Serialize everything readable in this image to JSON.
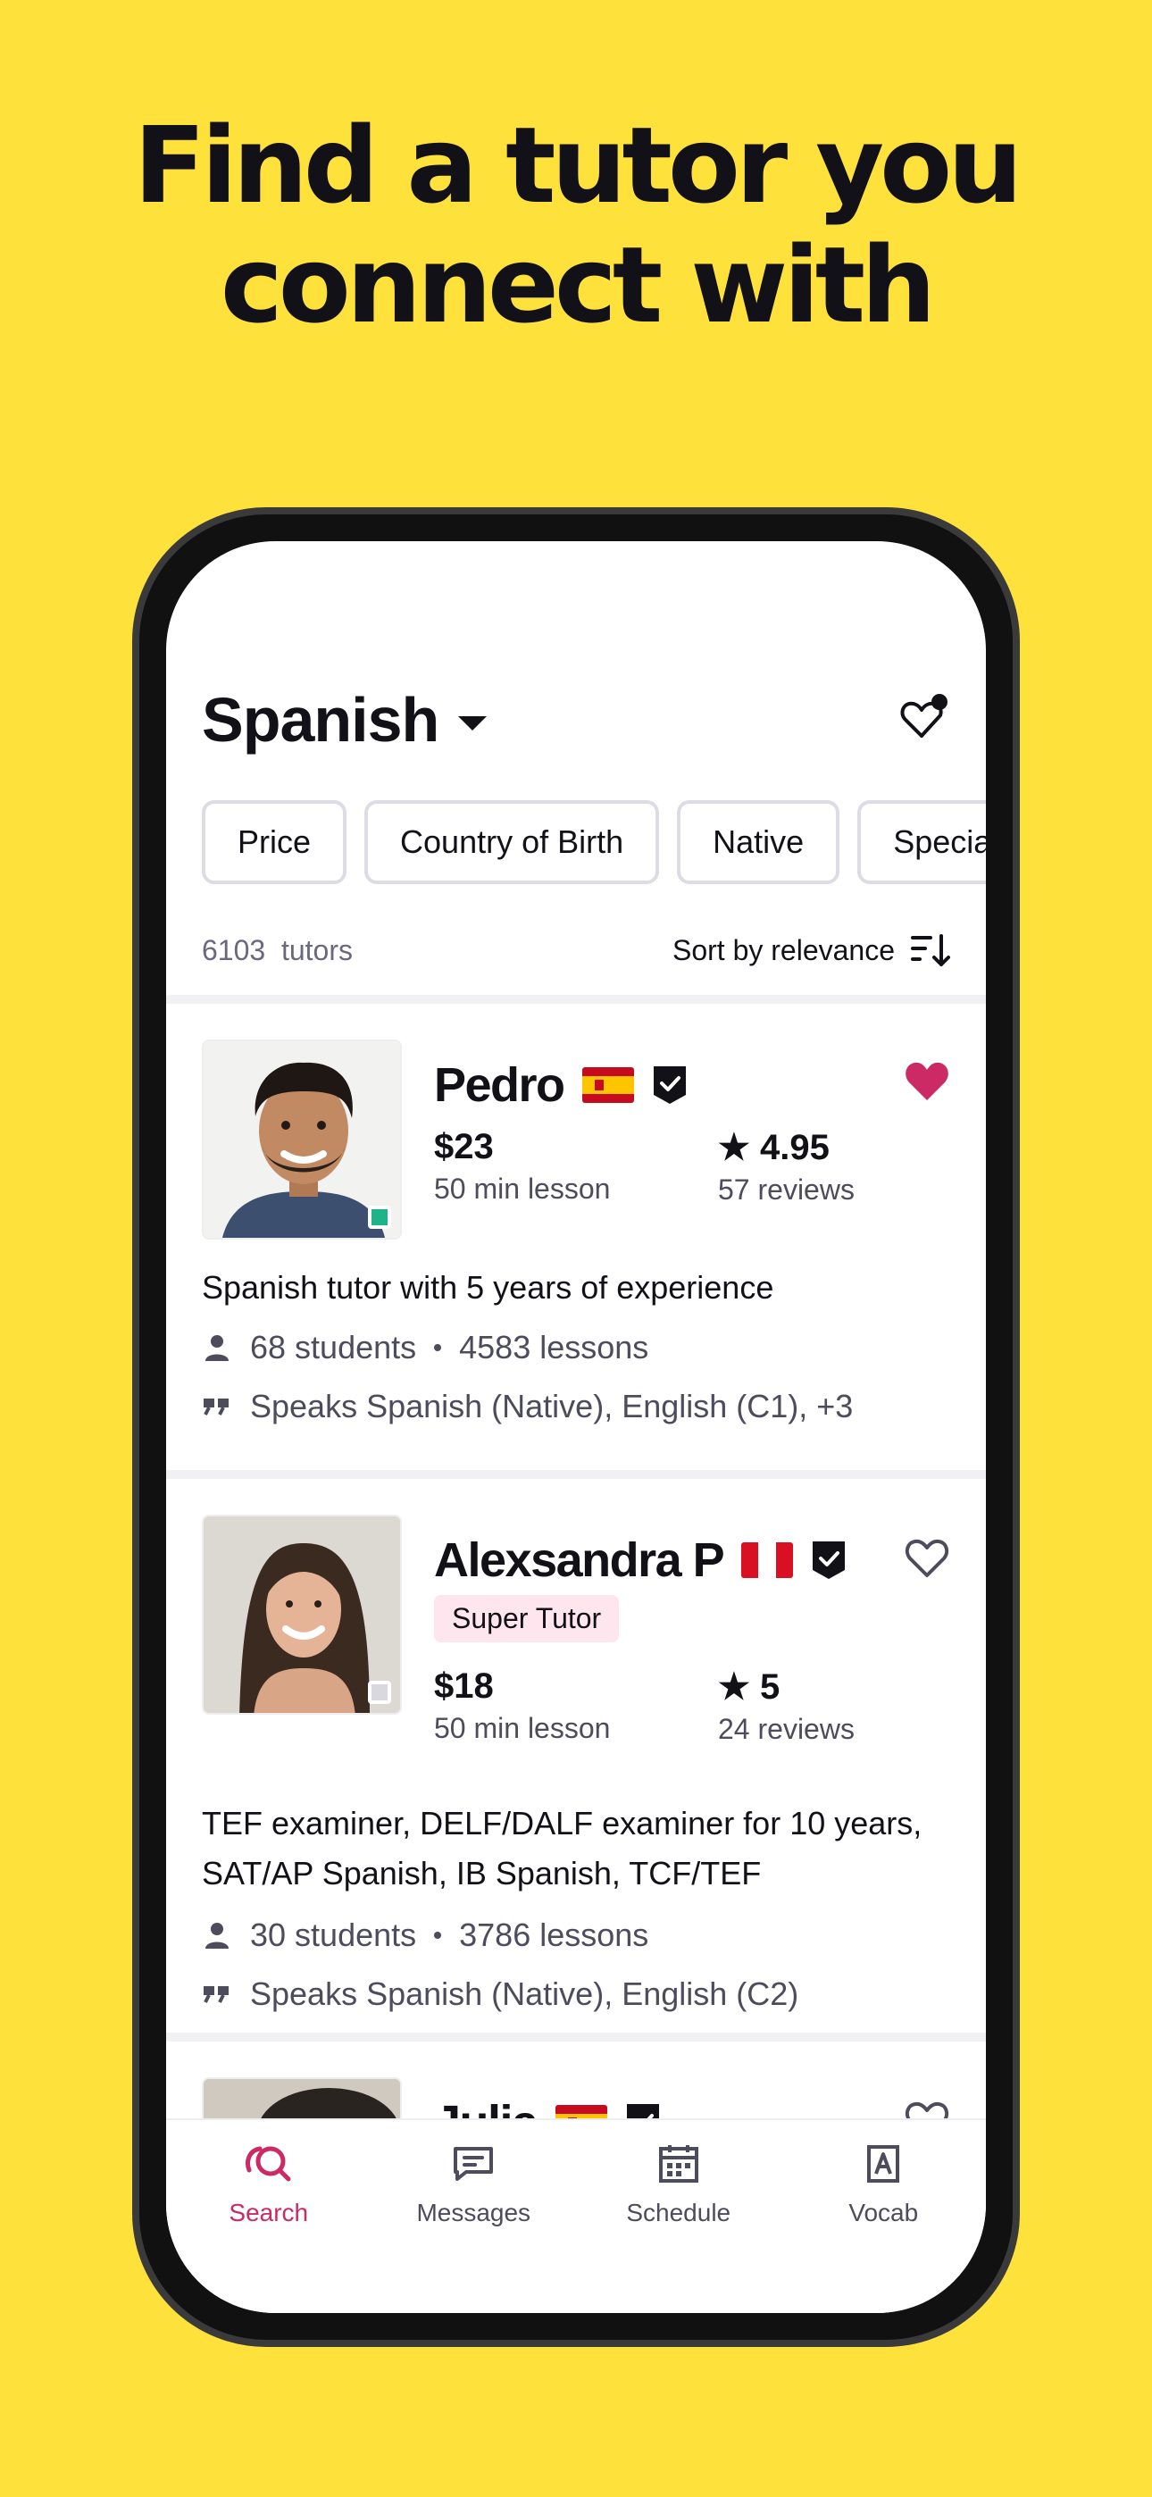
{
  "headline": {
    "line1": "Find a tutor you",
    "line2": "connect with"
  },
  "app": {
    "language": "Spanish",
    "filters": [
      "Price",
      "Country of Birth",
      "Native",
      "Specialties"
    ],
    "count": {
      "number": "6103",
      "label": "tutors"
    },
    "sort_label": "Sort by relevance",
    "tutors": [
      {
        "name": "Pedro",
        "flag": "spain",
        "favorite": true,
        "price": "$23",
        "lesson": "50 min lesson",
        "rating": "4.95",
        "reviews": "57 reviews",
        "headline": "Spanish tutor with 5 years of experience",
        "students": "68 students",
        "lessons": "4583 lessons",
        "speaks": "Speaks Spanish (Native), English (C1), +3",
        "online": true
      },
      {
        "name": "Alexsandra P",
        "flag": "peru",
        "favorite": false,
        "super_label": "Super Tutor",
        "price": "$18",
        "lesson": "50 min lesson",
        "rating": "5",
        "reviews": "24 reviews",
        "headline": "TEF examiner, DELF/DALF examiner for 10 years, SAT/AP Spanish, IB Spanish, TCF/TEF",
        "students": "30 students",
        "lessons": "3786 lessons",
        "speaks": "Speaks Spanish (Native), English (C2)",
        "online": false
      },
      {
        "name": "Julia",
        "flag": "spain",
        "favorite": false
      }
    ],
    "tabs": [
      {
        "label": "Search",
        "icon": "search-icon",
        "active": true
      },
      {
        "label": "Messages",
        "icon": "messages-icon",
        "active": false
      },
      {
        "label": "Schedule",
        "icon": "calendar-icon",
        "active": false
      },
      {
        "label": "Vocab",
        "icon": "vocab-icon",
        "active": false
      }
    ]
  },
  "colors": {
    "background": "#FFE13C",
    "accent": "#CC2A64",
    "online": "#1FB38A"
  }
}
